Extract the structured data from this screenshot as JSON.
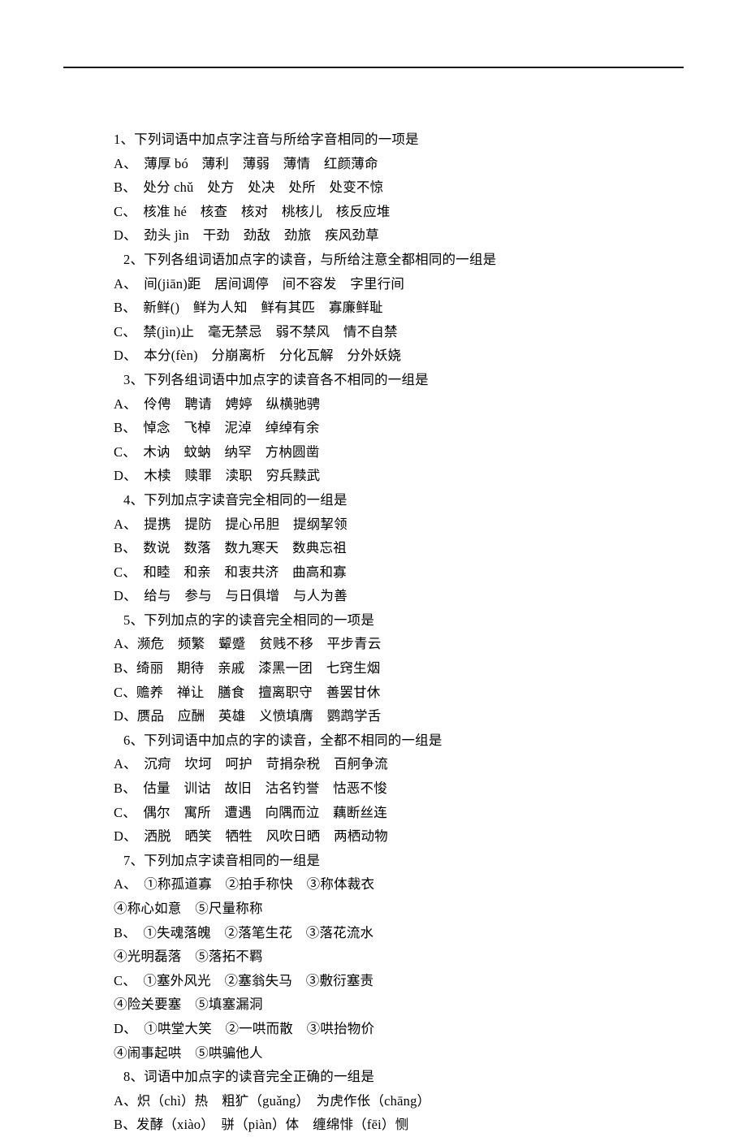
{
  "document": {
    "type": "chinese-language-exam-worksheet",
    "background_color": "#ffffff",
    "text_color": "#000000",
    "rule_color": "#1a1a1a"
  },
  "questions": [
    {
      "stem": "1、下列词语中加点字注音与所给字音相同的一项是",
      "indented": false,
      "options": [
        {
          "line": "A、　薄厚 bó　薄利　薄弱　薄情　红颜薄命",
          "continuation": null
        },
        {
          "line": "B、　处分 chǔ　处方　处决　处所　处变不惊",
          "continuation": null
        },
        {
          "line": "C、　核准 hé　核查　核对　桃核儿　核反应堆",
          "continuation": null
        },
        {
          "line": "D、　劲头 jìn　干劲　劲敌　劲旅　疾风劲草",
          "continuation": null
        }
      ]
    },
    {
      "stem": "2、下列各组词语加点字的读音，与所给注意全都相同的一组是",
      "indented": true,
      "options": [
        {
          "line": "A、　间(jiān)距　居间调停　间不容发　字里行间",
          "continuation": null
        },
        {
          "line": "B、　新鲜()　鲜为人知　鲜有其匹　寡廉鲜耻",
          "continuation": null
        },
        {
          "line": "C、　禁(jìn)止　毫无禁忌　弱不禁风　情不自禁",
          "continuation": null
        },
        {
          "line": "D、　本分(fèn)　分崩离析　分化瓦解　分外妖娆",
          "continuation": null
        }
      ]
    },
    {
      "stem": "3、下列各组词语中加点字的读音各不相同的一组是",
      "indented": true,
      "options": [
        {
          "line": "A、　伶俜　聘请　娉婷　纵横驰骋",
          "continuation": null
        },
        {
          "line": "B、　悼念　飞棹　泥淖　绰绰有余",
          "continuation": null
        },
        {
          "line": "C、　木讷　蚊蚋　纳罕　方枘圆凿",
          "continuation": null
        },
        {
          "line": "D、　木椟　赎罪　渎职　穷兵黩武",
          "continuation": null
        }
      ]
    },
    {
      "stem": "4、下列加点字读音完全相同的一组是",
      "indented": true,
      "options": [
        {
          "line": "A、　提携　提防　提心吊胆　提纲挈领",
          "continuation": null
        },
        {
          "line": "B、　数说　数落　数九寒天　数典忘祖",
          "continuation": null
        },
        {
          "line": "C、　和睦　和亲　和衷共济　曲高和寡",
          "continuation": null
        },
        {
          "line": "D、　给与　参与　与日俱增　与人为善",
          "continuation": null
        }
      ]
    },
    {
      "stem": "5、下列加点的字的读音完全相同的一项是",
      "indented": true,
      "options": [
        {
          "line": "A、濒危　频繁　颦蹙　贫贱不移　平步青云",
          "continuation": null
        },
        {
          "line": "B、绮丽　期待　亲戚　漆黑一团　七窍生烟",
          "continuation": null
        },
        {
          "line": "C、赡养　禅让　膳食　擅离职守　善罢甘休",
          "continuation": null
        },
        {
          "line": "D、赝品　应酬　英雄　义愤填膺　鹦鹉学舌",
          "continuation": null
        }
      ]
    },
    {
      "stem": "6、下列词语中加点的字的读音，全都不相同的一组是",
      "indented": true,
      "options": [
        {
          "line": "A、　沉疴　坎坷　呵护　苛捐杂税　百舸争流",
          "continuation": null
        },
        {
          "line": "B、　估量　训诂　故旧　沽名钓誉　怙恶不悛",
          "continuation": null
        },
        {
          "line": "C、　偶尔　寓所　遭遇　向隅而泣　藕断丝连",
          "continuation": null
        },
        {
          "line": "D、　洒脱　晒笑　牺牲　风吹日晒　两栖动物",
          "continuation": null
        }
      ]
    },
    {
      "stem": "7、下列加点字读音相同的一组是",
      "indented": true,
      "options": [
        {
          "line": "A、　①称孤道寡　②拍手称快　③称体裁衣",
          "continuation": "④称心如意　⑤尺量称称"
        },
        {
          "line": "B、　①失魂落魄　②落笔生花　③落花流水",
          "continuation": "④光明磊落　⑤落拓不羁"
        },
        {
          "line": "C、　①塞外风光　②塞翁失马　③敷衍塞责",
          "continuation": "④险关要塞　⑤填塞漏洞"
        },
        {
          "line": "D、　①哄堂大笑　②一哄而散　③哄抬物价",
          "continuation": "④闹事起哄　⑤哄骗他人"
        }
      ]
    },
    {
      "stem": "8、词语中加点字的读音完全正确的一组是",
      "indented": true,
      "options": [
        {
          "line": "A、炽（chì）热　粗犷（guǎng）　为虎作伥（chāng）",
          "continuation": null
        },
        {
          "line": "B、发酵（xiào）　骈（piàn）体　缠绵悱（fēi）恻",
          "continuation": null
        }
      ]
    }
  ]
}
